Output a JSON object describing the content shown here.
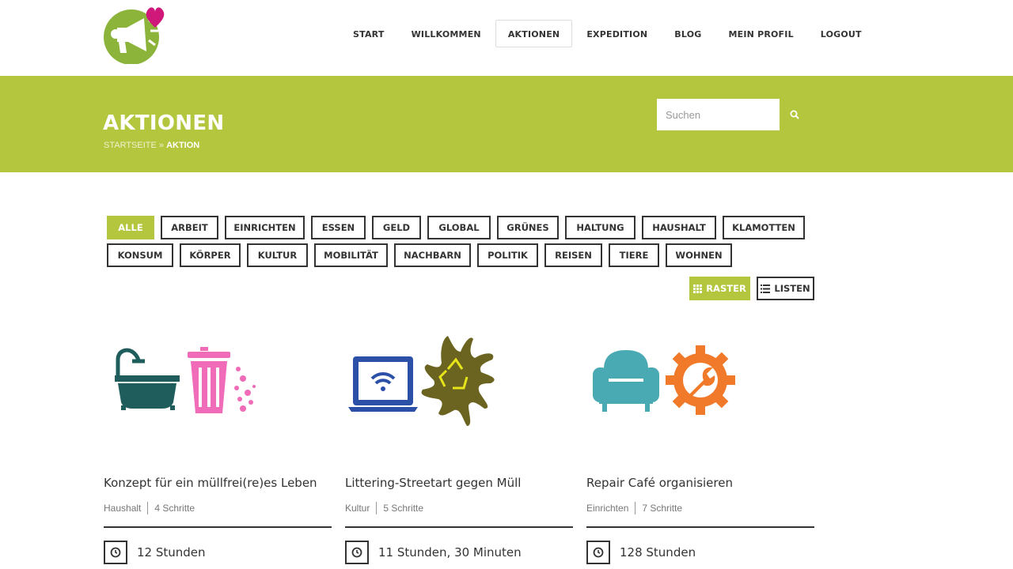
{
  "nav": {
    "items": [
      {
        "label": "START"
      },
      {
        "label": "WILLKOMMEN"
      },
      {
        "label": "AKTIONEN",
        "active": true
      },
      {
        "label": "EXPEDITION"
      },
      {
        "label": "BLOG"
      },
      {
        "label": "MEIN PROFIL"
      },
      {
        "label": "LOGOUT"
      }
    ]
  },
  "banner": {
    "title": "AKTIONEN",
    "breadcrumb_home": "STARTSEITE",
    "breadcrumb_sep": "»",
    "breadcrumb_current": "AKTION",
    "search_placeholder": "Suchen",
    "color": "#b3c63d"
  },
  "filters": {
    "row1": [
      "ALLE",
      "ARBEIT",
      "EINRICHTEN",
      "ESSEN",
      "GELD",
      "GLOBAL",
      "GRÜNES",
      "HALTUNG",
      "HAUSHALT",
      "KLAMOTTEN"
    ],
    "row2": [
      "KONSUM",
      "KÖRPER",
      "KULTUR",
      "MOBILITÄT",
      "NACHBARN",
      "POLITIK",
      "REISEN",
      "TIERE",
      "WOHNEN"
    ],
    "active": "ALLE"
  },
  "view": {
    "raster_label": "RASTER",
    "list_label": "LISTEN"
  },
  "cards": [
    {
      "title": "Konzept für ein müllfrei(re)es Leben",
      "category": "Haushalt",
      "steps": "4 Schritte",
      "time": "12 Stunden"
    },
    {
      "title": "Littering-Streetart gegen Müll",
      "category": "Kultur",
      "steps": "5 Schritte",
      "time": "11 Stunden, 30 Minuten"
    },
    {
      "title": "Repair Café organisieren",
      "category": "Einrichten",
      "steps": "7 Schritte",
      "time": "128 Stunden"
    }
  ]
}
